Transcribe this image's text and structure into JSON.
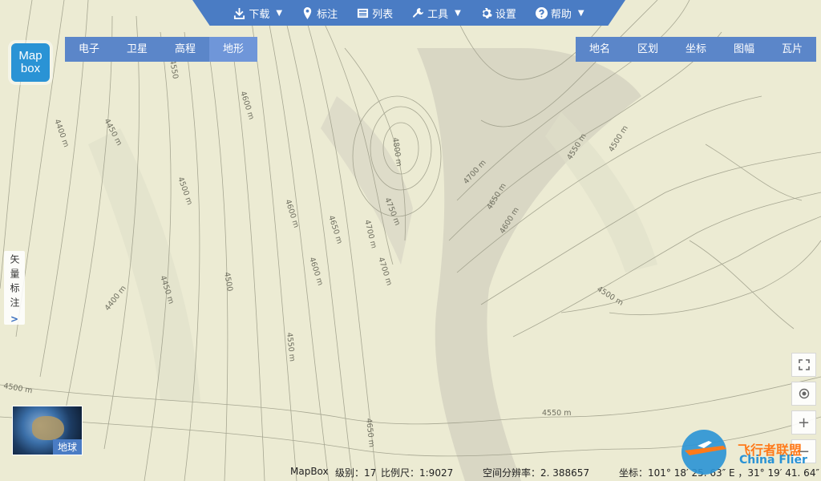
{
  "logo": {
    "line1": "Map",
    "line2": "box"
  },
  "toolbar": {
    "items": [
      {
        "label": "下载",
        "icon": "download-icon",
        "dropdown": true
      },
      {
        "label": "标注",
        "icon": "marker-icon",
        "dropdown": false
      },
      {
        "label": "列表",
        "icon": "list-icon",
        "dropdown": false
      },
      {
        "label": "工具",
        "icon": "tools-icon",
        "dropdown": true
      },
      {
        "label": "设置",
        "icon": "gear-icon",
        "dropdown": false
      },
      {
        "label": "帮助",
        "icon": "help-icon",
        "dropdown": true
      }
    ]
  },
  "map_types": [
    "电子",
    "卫星",
    "高程",
    "地形"
  ],
  "active_map_type": "地形",
  "overlays": [
    "地名",
    "区划",
    "坐标",
    "图幅",
    "瓦片"
  ],
  "side_panel": {
    "label": "矢量标注"
  },
  "globe_button": {
    "label": "地球"
  },
  "zoom_controls": [
    "fullscreen-icon",
    "locate-icon",
    "zoom-in-icon",
    "zoom-out-icon"
  ],
  "status": {
    "brand": "MapBox",
    "level": "级别：17",
    "scale": "比例尺：1:9027",
    "resolution": "空间分辨率：2. 388657",
    "coords": "坐标：101° 18′ 25. 63″ E ，31° 19′ 41. 64″ N"
  },
  "contour_labels": [
    "4400 m",
    "4450 m",
    "4500 m",
    "4450 m",
    "4400 m",
    "4600 m",
    "4550",
    "4500",
    "4600 m",
    "4650 m",
    "4600 m",
    "4550 m",
    "4700 m",
    "4700 m",
    "4750 m",
    "4800 m",
    "4700 m",
    "4650 m",
    "4600 m",
    "4550 m",
    "4500 m",
    "4500 m",
    "4550 m",
    "4650 m",
    "4500 m"
  ],
  "watermark": {
    "cn": "飞行者联盟",
    "en": "China Flier"
  },
  "colors": {
    "accent": "#4a7cc4",
    "map_bg": "#ecebd3",
    "contour": "#9a9a86"
  }
}
